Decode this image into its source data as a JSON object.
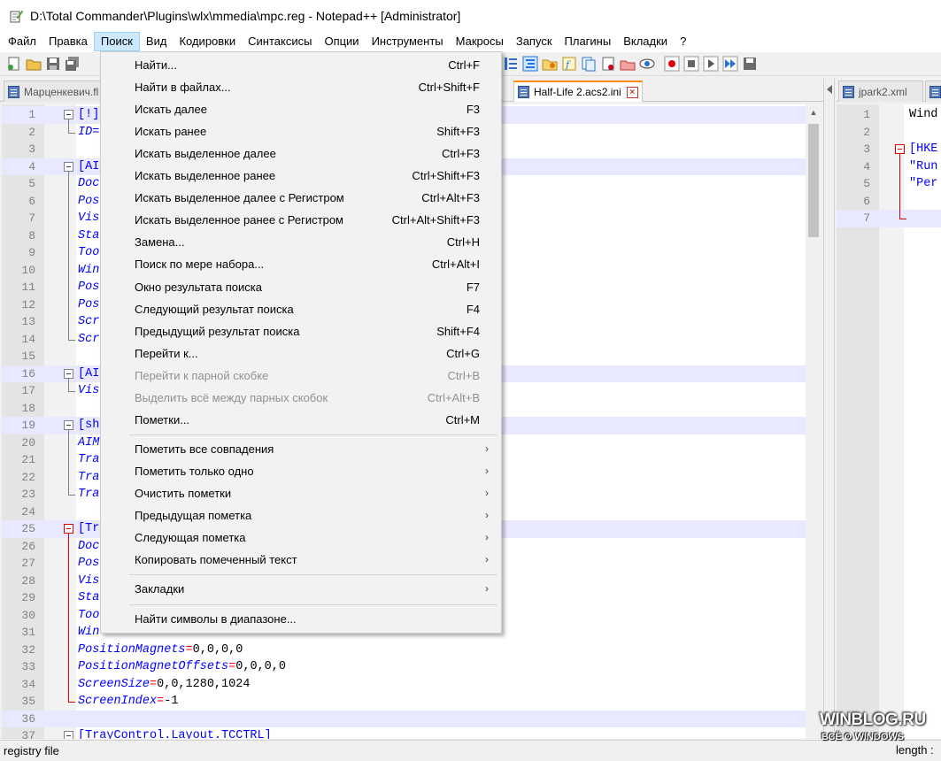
{
  "window": {
    "title": "D:\\Total Commander\\Plugins\\wlx\\mmedia\\mpc.reg - Notepad++ [Administrator]"
  },
  "menubar": [
    {
      "label": "Файл",
      "active": false
    },
    {
      "label": "Правка",
      "active": false
    },
    {
      "label": "Поиск",
      "active": true
    },
    {
      "label": "Вид",
      "active": false
    },
    {
      "label": "Кодировки",
      "active": false
    },
    {
      "label": "Синтаксисы",
      "active": false
    },
    {
      "label": "Опции",
      "active": false
    },
    {
      "label": "Инструменты",
      "active": false
    },
    {
      "label": "Макросы",
      "active": false
    },
    {
      "label": "Запуск",
      "active": false
    },
    {
      "label": "Плагины",
      "active": false
    },
    {
      "label": "Вкладки",
      "active": false
    },
    {
      "label": "?",
      "active": false
    }
  ],
  "tabs_left": [
    {
      "label": "Марценкевич.fl",
      "active": false
    },
    {
      "label": "Half-Life 2.acs2.ini",
      "active": true
    }
  ],
  "tabs_right": [
    {
      "label": "jpark2.xml",
      "active": false
    }
  ],
  "search_menu": {
    "items": [
      {
        "label": "Найти...",
        "shortcut": "Ctrl+F"
      },
      {
        "label": "Найти в файлах...",
        "shortcut": "Ctrl+Shift+F"
      },
      {
        "label": "Искать далее",
        "shortcut": "F3"
      },
      {
        "label": "Искать ранее",
        "shortcut": "Shift+F3"
      },
      {
        "label": "Искать выделенное далее",
        "shortcut": "Ctrl+F3"
      },
      {
        "label": "Искать выделенное ранее",
        "shortcut": "Ctrl+Shift+F3"
      },
      {
        "label": "Искать выделенное далее с Регистром",
        "shortcut": "Ctrl+Alt+F3"
      },
      {
        "label": "Искать выделенное ранее с Регистром",
        "shortcut": "Ctrl+Alt+Shift+F3"
      },
      {
        "label": "Замена...",
        "shortcut": "Ctrl+H"
      },
      {
        "label": "Поиск по мере набора...",
        "shortcut": "Ctrl+Alt+I"
      },
      {
        "label": "Окно результата поиска",
        "shortcut": "F7"
      },
      {
        "label": "Следующий результат поиска",
        "shortcut": "F4"
      },
      {
        "label": "Предыдущий результат поиска",
        "shortcut": "Shift+F4"
      },
      {
        "label": "Перейти к...",
        "shortcut": "Ctrl+G"
      },
      {
        "label": "Перейти к парной скобке",
        "shortcut": "Ctrl+B",
        "disabled": true
      },
      {
        "label": "Выделить всё между парных скобок",
        "shortcut": "Ctrl+Alt+B",
        "disabled": true
      },
      {
        "label": "Пометки...",
        "shortcut": "Ctrl+M"
      },
      {
        "label": "Пометить все совпадения",
        "submenu": true
      },
      {
        "label": "Пометить только одно",
        "submenu": true
      },
      {
        "label": "Очистить пометки",
        "submenu": true
      },
      {
        "label": "Предыдущая пометка",
        "submenu": true
      },
      {
        "label": "Следующая пометка",
        "submenu": true
      },
      {
        "label": "Копировать помеченный текст",
        "submenu": true
      },
      {
        "label": "Закладки",
        "submenu": true
      },
      {
        "label": "Найти символы в диапазоне..."
      }
    ]
  },
  "editor_left": {
    "lines": [
      {
        "n": "1",
        "parts": [
          {
            "t": "[!]",
            "c": "s"
          }
        ]
      },
      {
        "n": "2",
        "parts": [
          {
            "t": "ID=",
            "c": "k"
          }
        ]
      },
      {
        "n": "3",
        "parts": []
      },
      {
        "n": "4",
        "parts": [
          {
            "t": "[AI",
            "c": "s"
          }
        ]
      },
      {
        "n": "5",
        "parts": [
          {
            "t": "Doc",
            "c": "k"
          }
        ]
      },
      {
        "n": "6",
        "parts": [
          {
            "t": "Pos",
            "c": "k"
          }
        ]
      },
      {
        "n": "7",
        "parts": [
          {
            "t": "Vis",
            "c": "k"
          }
        ]
      },
      {
        "n": "8",
        "parts": [
          {
            "t": "Sta",
            "c": "k"
          }
        ]
      },
      {
        "n": "9",
        "parts": [
          {
            "t": "Too",
            "c": "k"
          }
        ]
      },
      {
        "n": "10",
        "parts": [
          {
            "t": "Win",
            "c": "k"
          }
        ]
      },
      {
        "n": "11",
        "parts": [
          {
            "t": "Pos",
            "c": "k"
          }
        ]
      },
      {
        "n": "12",
        "parts": [
          {
            "t": "Pos",
            "c": "k"
          }
        ]
      },
      {
        "n": "13",
        "parts": [
          {
            "t": "Scr",
            "c": "k"
          }
        ]
      },
      {
        "n": "14",
        "parts": [
          {
            "t": "Scr",
            "c": "k"
          }
        ]
      },
      {
        "n": "15",
        "parts": []
      },
      {
        "n": "16",
        "parts": [
          {
            "t": "[AI",
            "c": "s"
          }
        ]
      },
      {
        "n": "17",
        "parts": [
          {
            "t": "Vis",
            "c": "k"
          }
        ]
      },
      {
        "n": "18",
        "parts": []
      },
      {
        "n": "19",
        "parts": [
          {
            "t": "[sh",
            "c": "s"
          }
        ]
      },
      {
        "n": "20",
        "parts": [
          {
            "t": "AIM",
            "c": "k"
          }
        ]
      },
      {
        "n": "21",
        "parts": [
          {
            "t": "Tra",
            "c": "k"
          }
        ]
      },
      {
        "n": "22",
        "parts": [
          {
            "t": "Tra",
            "c": "k"
          }
        ]
      },
      {
        "n": "23",
        "parts": [
          {
            "t": "Tra",
            "c": "k"
          }
        ]
      },
      {
        "n": "24",
        "parts": []
      },
      {
        "n": "25",
        "parts": [
          {
            "t": "[Tr",
            "c": "s"
          }
        ]
      },
      {
        "n": "26",
        "parts": [
          {
            "t": "Doc",
            "c": "k"
          }
        ]
      },
      {
        "n": "27",
        "parts": [
          {
            "t": "Pos",
            "c": "k"
          }
        ]
      },
      {
        "n": "28",
        "parts": [
          {
            "t": "Vis",
            "c": "k"
          }
        ]
      },
      {
        "n": "29",
        "parts": [
          {
            "t": "Sta",
            "c": "k"
          }
        ]
      },
      {
        "n": "30",
        "parts": [
          {
            "t": "Too",
            "c": "k"
          }
        ]
      },
      {
        "n": "31",
        "parts": [
          {
            "t": "Win",
            "c": "k"
          }
        ]
      },
      {
        "n": "32",
        "parts": [
          {
            "t": "PositionMagnets",
            "c": "k"
          },
          {
            "t": "=",
            "c": "eq"
          },
          {
            "t": "0,0,0,0",
            "c": "v"
          }
        ]
      },
      {
        "n": "33",
        "parts": [
          {
            "t": "PositionMagnetOffsets",
            "c": "k"
          },
          {
            "t": "=",
            "c": "eq"
          },
          {
            "t": "0,0,0,0",
            "c": "v"
          }
        ]
      },
      {
        "n": "34",
        "parts": [
          {
            "t": "ScreenSize",
            "c": "k"
          },
          {
            "t": "=",
            "c": "eq"
          },
          {
            "t": "0,0,1280,1024",
            "c": "v"
          }
        ]
      },
      {
        "n": "35",
        "parts": [
          {
            "t": "ScreenIndex",
            "c": "k"
          },
          {
            "t": "=",
            "c": "eq"
          },
          {
            "t": "-1",
            "c": "v"
          }
        ]
      },
      {
        "n": "36",
        "parts": []
      },
      {
        "n": "37",
        "parts": [
          {
            "t": "[TrayControl.Layout.TCCTRL]",
            "c": "s"
          }
        ]
      }
    ]
  },
  "editor_right": {
    "lines": [
      {
        "n": "1",
        "parts": [
          {
            "t": "Wind",
            "c": "v"
          }
        ]
      },
      {
        "n": "2",
        "parts": []
      },
      {
        "n": "3",
        "parts": [
          {
            "t": "[HKE",
            "c": "s"
          }
        ]
      },
      {
        "n": "4",
        "parts": [
          {
            "t": "\"Run",
            "c": "s"
          }
        ]
      },
      {
        "n": "5",
        "parts": [
          {
            "t": "\"Per",
            "c": "s"
          }
        ]
      },
      {
        "n": "6",
        "parts": []
      },
      {
        "n": "7",
        "parts": []
      }
    ]
  },
  "statusbar": {
    "file_type": "registry file",
    "length_label": "length :"
  },
  "watermark": {
    "line1": "WINBLOG.RU",
    "line2": "ВСЁ О WINDOWS"
  }
}
